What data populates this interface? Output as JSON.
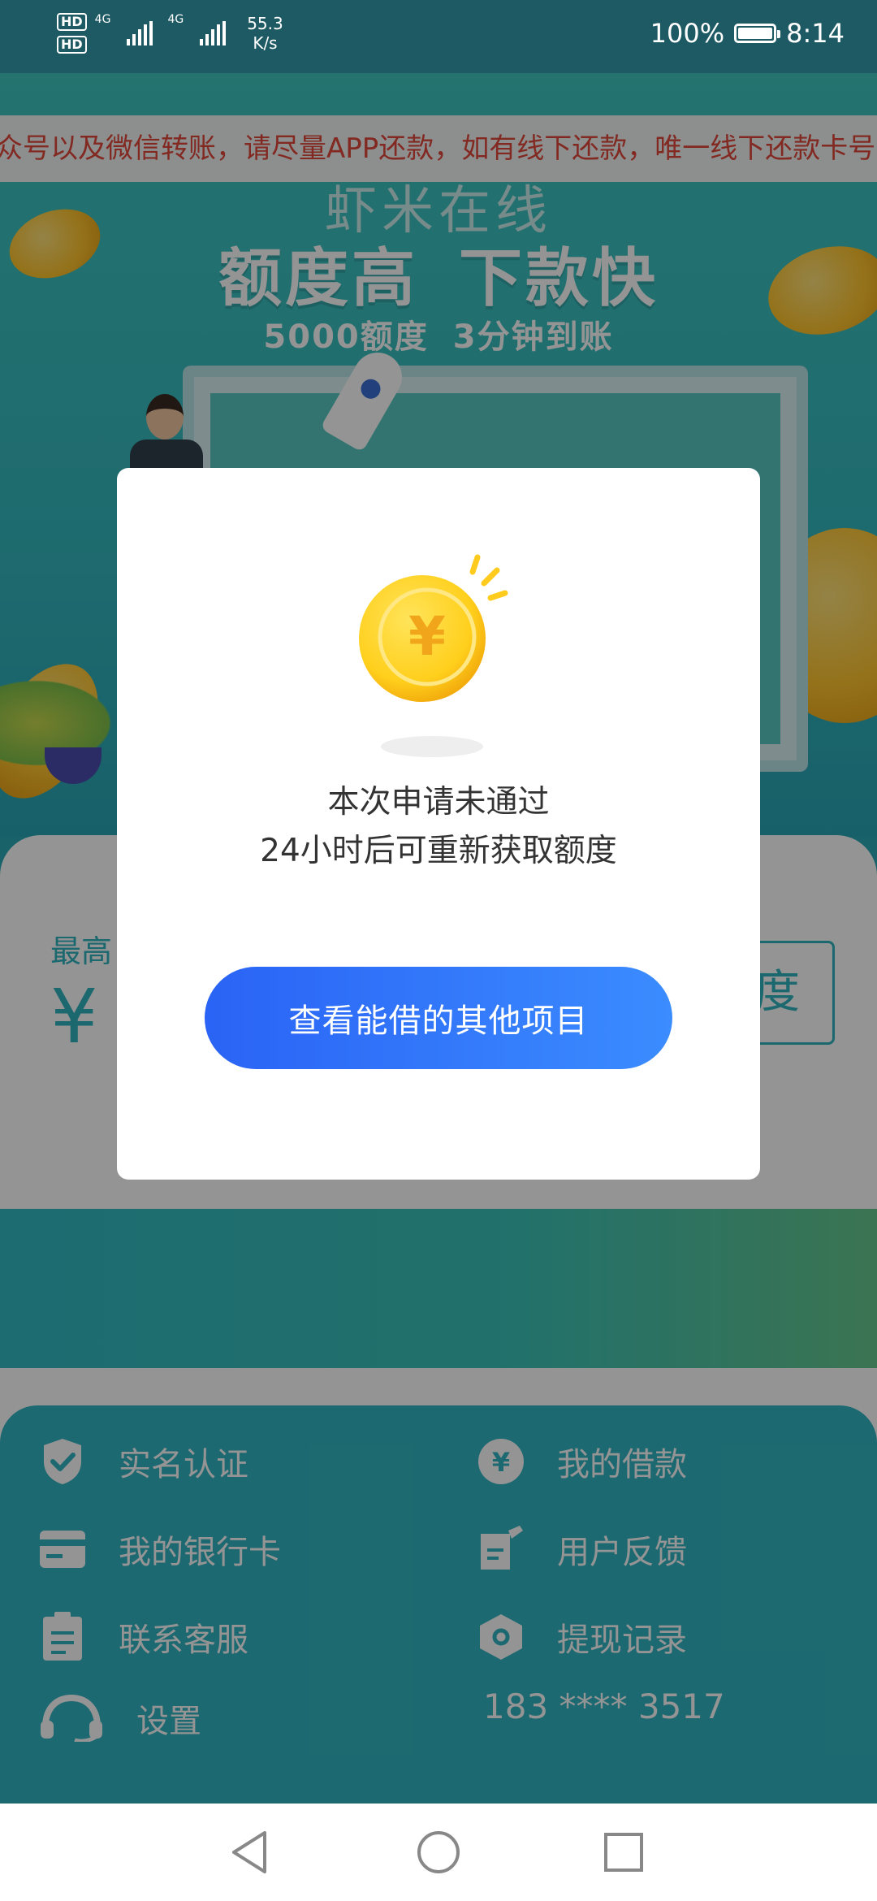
{
  "status_bar": {
    "hd1": "HD",
    "hd2": "HD",
    "net1": "4G",
    "net2": "4G",
    "speed_value": "55.3",
    "speed_unit": "K/s",
    "battery_percent": "100%",
    "time": "8:14"
  },
  "banner": {
    "marquee_text": "众号以及微信转账，请尽量APP还款，如有线下还款，唯一线下还款卡号",
    "brand": "虾米在线",
    "title_left": "额度高",
    "title_right": "下款快",
    "subtitle_left": "5000额度",
    "subtitle_right": "3分钟到账"
  },
  "quota_card": {
    "label_visible": "最高",
    "currency_symbol": "¥",
    "button_visible_text": "度"
  },
  "dialog": {
    "message_line1": "本次申请未通过",
    "message_line2": "24小时后可重新获取额度",
    "action_label": "查看能借的其他项目"
  },
  "menu": {
    "items": [
      {
        "label": "实名认证",
        "icon": "shield-check-icon"
      },
      {
        "label": "我的借款",
        "icon": "yen-circle-icon"
      },
      {
        "label": "我的银行卡",
        "icon": "bank-card-icon"
      },
      {
        "label": "用户反馈",
        "icon": "feedback-icon"
      },
      {
        "label": "联系客服",
        "icon": "clipboard-icon"
      },
      {
        "label": "提现记录",
        "icon": "hexagon-record-icon"
      },
      {
        "label": "设置",
        "icon": "headset-icon"
      }
    ],
    "phone": "183 **** 3517"
  },
  "nav_bar": {
    "buttons": [
      "back-icon",
      "home-icon",
      "recents-icon"
    ]
  },
  "colors": {
    "accent": "#2fb3c0",
    "dialog_button_start": "#2a63f5",
    "dialog_button_end": "#3b8cff",
    "marquee_text": "#e0473b",
    "menu_background": "#33b6c3"
  }
}
